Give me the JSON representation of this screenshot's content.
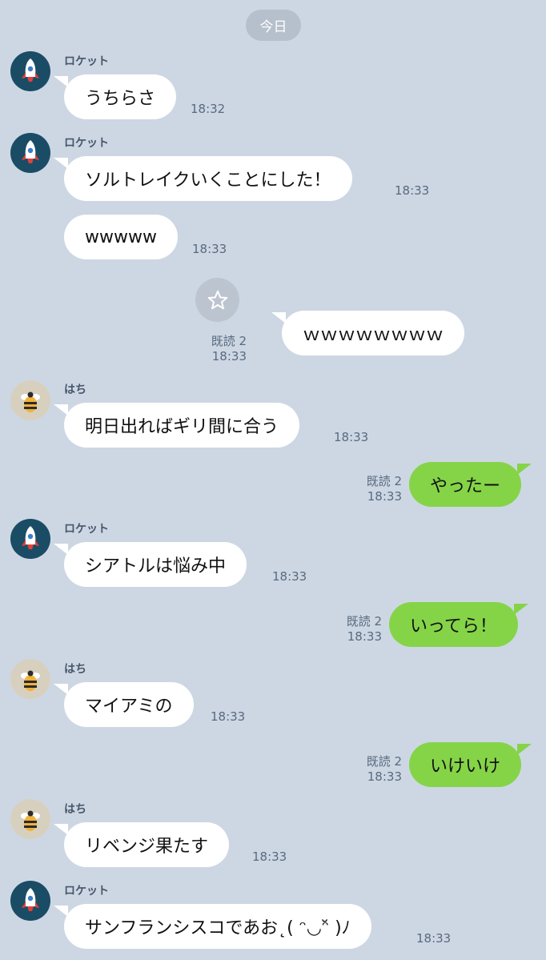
{
  "date_divider": "今日",
  "messages": [
    {
      "sender": "ロケット",
      "text": "うちらさ",
      "time": "18:32"
    },
    {
      "sender": "ロケット",
      "text": "ソルトレイクいくことにした！",
      "time": "18:33"
    },
    {
      "text": "wwwww",
      "time": "18:33"
    },
    {
      "text": "ｗｗｗｗｗｗｗｗ",
      "read": "既読 2",
      "time": "18:33"
    },
    {
      "sender": "はち",
      "text": "明日出ればギリ間に合う",
      "time": "18:33"
    },
    {
      "text": "やったー",
      "read": "既読 2",
      "time": "18:33"
    },
    {
      "sender": "ロケット",
      "text": "シアトルは悩み中",
      "time": "18:33"
    },
    {
      "text": "いってら！",
      "read": "既読 2",
      "time": "18:33"
    },
    {
      "sender": "はち",
      "text": "マイアミの",
      "time": "18:33"
    },
    {
      "text": "いけいけ",
      "read": "既読 2",
      "time": "18:33"
    },
    {
      "sender": "はち",
      "text": "リベンジ果たす",
      "time": "18:33"
    },
    {
      "sender": "ロケット",
      "text": "サンフランシスコであお˛( ᵔ◡ᵔ̆ )ﾉ",
      "time": "18:33"
    }
  ],
  "avatars": {
    "rocket": "rocket-icon",
    "bee": "bee-icon"
  },
  "colors": {
    "background": "#cdd7e3",
    "outgoing_bubble": "#85d448",
    "incoming_bubble": "#ffffff"
  }
}
